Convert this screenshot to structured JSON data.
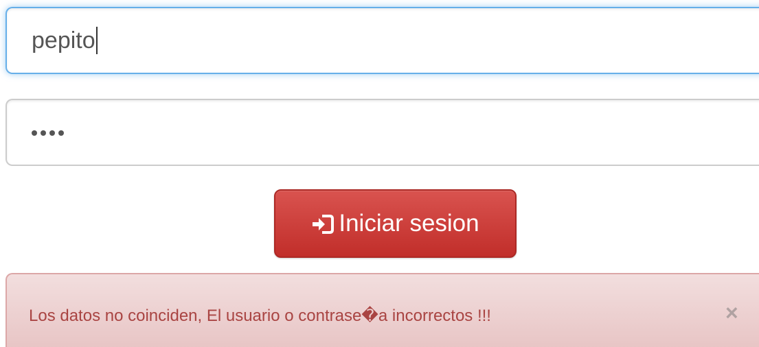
{
  "form": {
    "username": {
      "value": "pepito",
      "focused": true
    },
    "password": {
      "masked_length": 4
    },
    "login_button": {
      "label": "Iniciar sesion",
      "icon": "log-in-icon"
    }
  },
  "alert": {
    "message": "Los datos no coinciden, El usuario o contrase�a incorrectos !!!",
    "close_symbol": "×",
    "type": "danger"
  },
  "colors": {
    "button": "#d9534f",
    "alert_background": "#f2dede",
    "alert_text": "#a94442",
    "focus_border": "#66afe9"
  }
}
